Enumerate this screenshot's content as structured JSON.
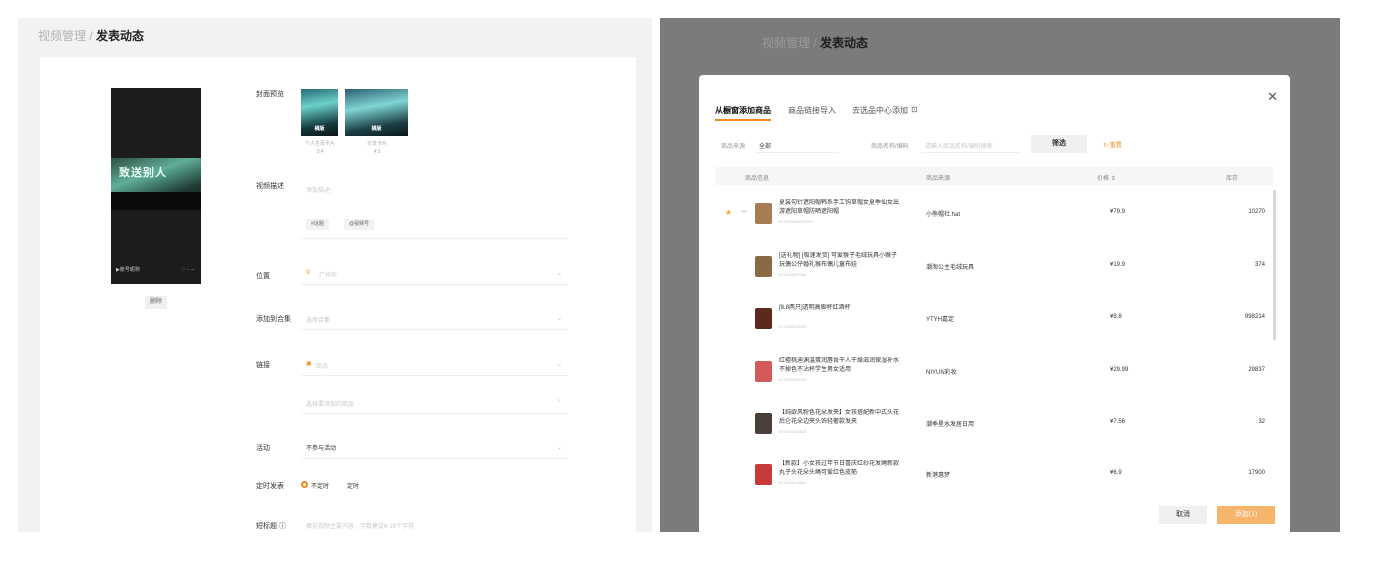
{
  "left": {
    "breadcrumb": {
      "parent": "视频管理",
      "separator": "/",
      "current": "发表动态"
    },
    "preview": {
      "video_text": "致送别人",
      "account": "▶账号昵称",
      "delete_label": "删除"
    },
    "cover_label": "封面预览",
    "covers": [
      {
        "tag": "横版",
        "caption": "个人主页卡片",
        "ratio": "3:4"
      },
      {
        "tag": "横版",
        "caption": "分享卡片",
        "ratio": "4:3"
      }
    ],
    "desc_label": "视频描述",
    "desc_placeholder": "添加描述",
    "topic_chip": "#话题",
    "mention_chip": "@视频号",
    "location_label": "位置",
    "location_value": "广州市",
    "collection_label": "添加到合集",
    "collection_placeholder": "选择合集",
    "link_label": "链接",
    "link_value": "商品",
    "product_placeholder": "选择要添加的商品",
    "activity_label": "活动",
    "activity_value": "不参与活动",
    "schedule_label": "定时发表",
    "schedule_options": [
      "不定时",
      "定时"
    ],
    "short_title_label": "短标题",
    "short_title_placeholder": "概括视频主要内容，字数建议6-16个字符"
  },
  "right": {
    "breadcrumb": {
      "parent": "视频管理",
      "separator": "/",
      "current": "发表动态"
    },
    "modal": {
      "tabs": [
        "从橱窗添加商品",
        "商品链接导入",
        "去选品中心添加"
      ],
      "filter": {
        "source_label": "商品来源",
        "source_value": "全部",
        "name_label": "商品名称/编码",
        "name_placeholder": "请输入商品名称/编码搜索",
        "filter_button": "筛选",
        "reset": "重置"
      },
      "columns": [
        "商品信息",
        "商品来源",
        "价格",
        "库存"
      ],
      "rows": [
        {
          "name": "夏装勾针遮阳帽韩系手工钩草帽女夏季仙女出游遮阳草帽防晒遮阳帽",
          "id": "ID:1000038476013",
          "source": "小熊帽社.hat",
          "price": "¥79.9",
          "stock": "10270",
          "color": "#a67c52",
          "selected": true
        },
        {
          "name": "[送礼物] [极速发货] 可爱猴子毛绒玩具小猴子玩偶公仔婚礼猴布偶儿童布娃",
          "id": "ID:1000007083",
          "source": "潮淘公主毛绒玩具",
          "price": "¥19.9",
          "stock": "374",
          "color": "#8a6a45",
          "selected": false
        },
        {
          "name": "[8.8两只]透明高脚杯红酒杯",
          "id": "ID:1000018409",
          "source": "YTYH嘉定",
          "price": "¥8.8",
          "stock": "998214",
          "color": "#5a2a1e",
          "selected": false
        },
        {
          "name": "红檀桃迪渊温蛋润唇膏干人干燥滋润保湿补水不掉色不沾杯学生男女适用",
          "id": "ID:1000014432",
          "source": "NIYUN彩妆",
          "price": "¥29.99",
          "stock": "29837",
          "color": "#d45a5a",
          "selected": false
        },
        {
          "name": "【纯欲风粉色花朵发夹】女孩搭配新中式头花后仑花朵边夹头饰轻奢款发夹",
          "id": "ID:1000028845",
          "source": "潮季星水发居日用",
          "price": "¥7.56",
          "stock": "32",
          "color": "#4a3f3a",
          "selected": false
        },
        {
          "name": "【新款】小女孩过年节日喜庆红纱花发绳新款丸子头花朵头绳可爱红色皮筋",
          "id": "ID:1000018884",
          "source": "新港惠梦",
          "price": "¥6.9",
          "stock": "17900",
          "color": "#c83a3a",
          "selected": false
        }
      ],
      "cancel": "取消",
      "confirm": "添加(1)"
    }
  }
}
